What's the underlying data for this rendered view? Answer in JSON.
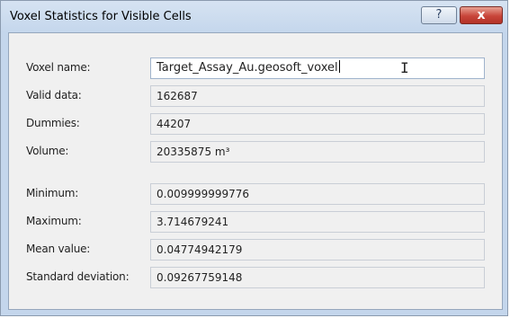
{
  "window": {
    "title": "Voxel Statistics for Visible Cells",
    "help_label": "?",
    "close_label": "x"
  },
  "stats": [
    {
      "label": "Voxel name:",
      "value": "Target_Assay_Au.geosoft_voxel"
    },
    {
      "label": "Valid data:",
      "value": "162687"
    },
    {
      "label": "Dummies:",
      "value": "44207"
    },
    {
      "label": "Volume:",
      "value": "20335875 m³"
    },
    {
      "label": "Minimum:",
      "value": "0.009999999776"
    },
    {
      "label": "Maximum:",
      "value": "3.714679241"
    },
    {
      "label": "Mean value:",
      "value": "0.04774942179"
    },
    {
      "label": "Standard deviation:",
      "value": "0.09267759148"
    }
  ]
}
